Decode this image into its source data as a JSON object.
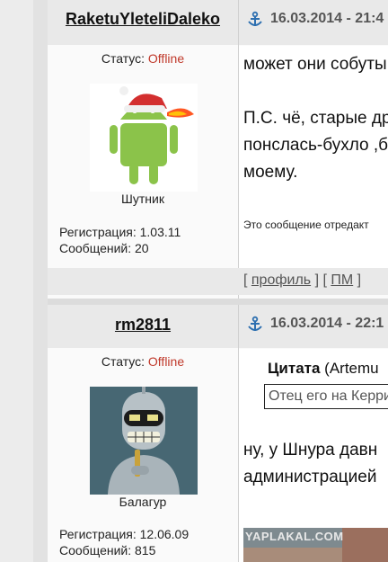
{
  "posts": [
    {
      "username": "RaketuYleteliDaleko",
      "date": "16.03.2014 - 21:4",
      "status_label": "Статус:",
      "status_value": "Offline",
      "rank": "Шутник",
      "registration": "Регистрация: 1.03.11",
      "messages": "Сообщений: 20",
      "text_lines": [
        "может они собуты",
        "",
        "П.С. чё, старые др",
        "понслась-бухло ,б",
        "моему."
      ],
      "edited": "Это сообщение отредакт",
      "profile_link": "профиль",
      "pm_link": "ПМ",
      "avatar_icon": "android-santa-avatar"
    },
    {
      "username": "rm2811",
      "date": "16.03.2014 - 22:1",
      "status_label": "Статус:",
      "status_value": "Offline",
      "rank": "Балагур",
      "registration": "Регистрация: 12.06.09",
      "messages": "Сообщений: 815",
      "quote_label": "Цитата",
      "quote_author": "(Artemu",
      "quote_text": "Отец его на Керри",
      "text_lines": [
        "ну, у Шнура давн",
        "администрацией"
      ],
      "image_watermark": "YAPLAKAL.COM",
      "avatar_icon": "bender-avatar"
    }
  ],
  "colors": {
    "offline": "#c0392b",
    "header_bg": "#e9e9e9",
    "anchor": "#2d6fb0"
  }
}
